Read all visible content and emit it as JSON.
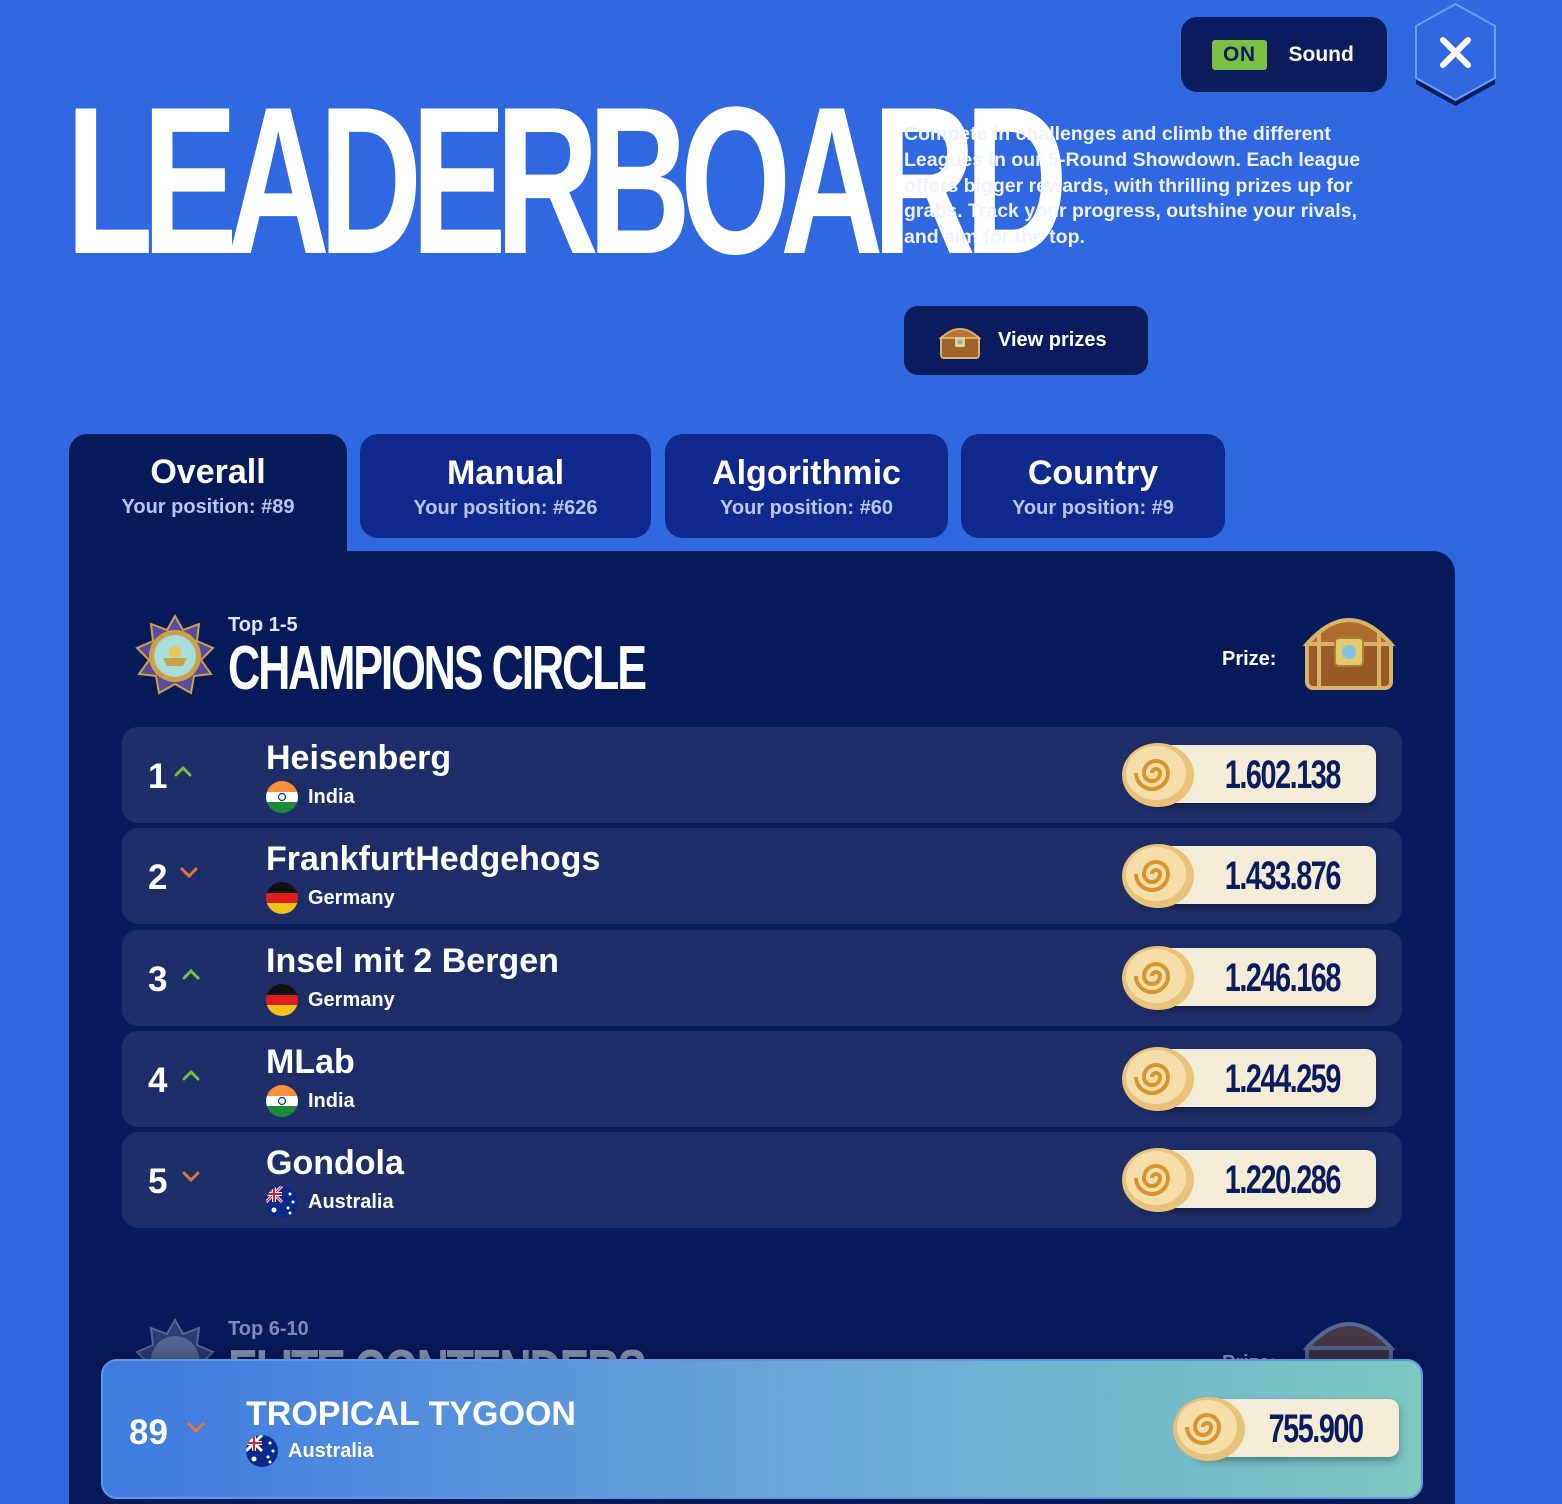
{
  "sound": {
    "state": "ON",
    "label": "Sound"
  },
  "title": "LEADERBOARD",
  "intro": "Compete in challenges and climb the different Leagues in our 5-Round Showdown. Each league offers bigger rewards, with thrilling prizes up for grabs. Track your progress, outshine your rivals, and aim for the top.",
  "view_prizes": "View prizes",
  "tabs": [
    {
      "name": "Overall",
      "position": "Your position: #89",
      "active": true
    },
    {
      "name": "Manual",
      "position": "Your position: #626",
      "active": false
    },
    {
      "name": "Algorithmic",
      "position": "Your position: #60",
      "active": false
    },
    {
      "name": "Country",
      "position": "Your position: #9",
      "active": false
    }
  ],
  "sections": [
    {
      "range": "Top 1-5",
      "title": "CHAMPIONS CIRCLE",
      "prize_label": "Prize:",
      "rows": [
        {
          "rank": "1",
          "trend": "up",
          "name": "Heisenberg",
          "country": "India",
          "flag": "india",
          "score": "1.602.138"
        },
        {
          "rank": "2",
          "trend": "down",
          "name": "FrankfurtHedgehogs",
          "country": "Germany",
          "flag": "germany",
          "score": "1.433.876"
        },
        {
          "rank": "3",
          "trend": "up",
          "name": "Insel mit 2 Bergen",
          "country": "Germany",
          "flag": "germany",
          "score": "1.246.168"
        },
        {
          "rank": "4",
          "trend": "up",
          "name": "MLab",
          "country": "India",
          "flag": "india",
          "score": "1.244.259"
        },
        {
          "rank": "5",
          "trend": "down",
          "name": "Gondola",
          "country": "Australia",
          "flag": "australia",
          "score": "1.220.286"
        }
      ]
    },
    {
      "range": "Top 6-10",
      "title": "ELITE CONTENDERS",
      "prize_label": "Prize:"
    }
  ],
  "current_player": {
    "rank": "89",
    "trend": "down",
    "name": "TROPICAL TYGOON",
    "country": "Australia",
    "flag": "australia",
    "score": "755.900"
  },
  "colors": {
    "background": "#2f68e0",
    "panel": "#071b5b",
    "row": "#1e2e69",
    "trend_up": "#7ac143",
    "trend_down": "#e0763a",
    "score_pill": "#f3ecd6"
  }
}
